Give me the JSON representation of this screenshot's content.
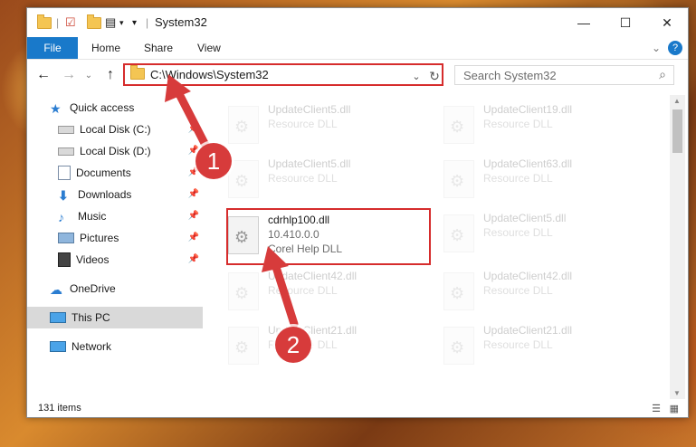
{
  "window": {
    "title": "System32"
  },
  "controls": {
    "minimize": "—",
    "maximize": "☐",
    "close": "✕"
  },
  "ribbon": {
    "tabs": [
      "File",
      "Home",
      "Share",
      "View"
    ],
    "help": "?",
    "expand": "⌄"
  },
  "nav": {
    "back": "←",
    "forward": "→",
    "dropdown": "⌄",
    "up": "↑",
    "address": "C:\\Windows\\System32",
    "refresh": "↻",
    "addr_dropdown": "⌄",
    "search_placeholder": "Search System32",
    "search_icon": "⌕"
  },
  "sidebar": [
    {
      "label": "Quick access",
      "icon": "star-icon",
      "pinned": false
    },
    {
      "label": "Local Disk (C:)",
      "icon": "drive-icon",
      "pinned": true
    },
    {
      "label": "Local Disk (D:)",
      "icon": "drive-icon",
      "pinned": true
    },
    {
      "label": "Documents",
      "icon": "documents-icon",
      "pinned": true
    },
    {
      "label": "Downloads",
      "icon": "download-icon",
      "pinned": true
    },
    {
      "label": "Music",
      "icon": "music-icon",
      "pinned": true
    },
    {
      "label": "Pictures",
      "icon": "pictures-icon",
      "pinned": true
    },
    {
      "label": "Videos",
      "icon": "videos-icon",
      "pinned": true
    },
    {
      "label": "OneDrive",
      "icon": "cloud-icon",
      "pinned": false
    },
    {
      "label": "This PC",
      "icon": "computer-icon",
      "pinned": false
    },
    {
      "label": "Network",
      "icon": "network-icon",
      "pinned": false
    }
  ],
  "files": [
    {
      "name": "UpdateClient5.dll",
      "desc": "Resource DLL",
      "version": ""
    },
    {
      "name": "UpdateClient19.dll",
      "desc": "Resource DLL",
      "version": ""
    },
    {
      "name": "UpdateClient5.dll",
      "desc": "Resource DLL",
      "version": ""
    },
    {
      "name": "UpdateClient63.dll",
      "desc": "Resource DLL",
      "version": ""
    },
    {
      "name": "cdrhlp100.dll",
      "desc": "Corel Help DLL",
      "version": "10.410.0.0"
    },
    {
      "name": "UpdateClient5.dll",
      "desc": "Resource DLL",
      "version": ""
    },
    {
      "name": "UpdateClient42.dll",
      "desc": "Resource DLL",
      "version": ""
    },
    {
      "name": "UpdateClient42.dll",
      "desc": "Resource DLL",
      "version": ""
    },
    {
      "name": "UpdateClient21.dll",
      "desc": "Resource DLL",
      "version": ""
    },
    {
      "name": "UpdateClient21.dll",
      "desc": "Resource DLL",
      "version": ""
    }
  ],
  "status": {
    "count": "131 items"
  },
  "annotations": {
    "step1": "1",
    "step2": "2"
  },
  "colors": {
    "accent": "#1979ca",
    "highlight": "#d62c2c",
    "badge": "#d73b3b"
  }
}
